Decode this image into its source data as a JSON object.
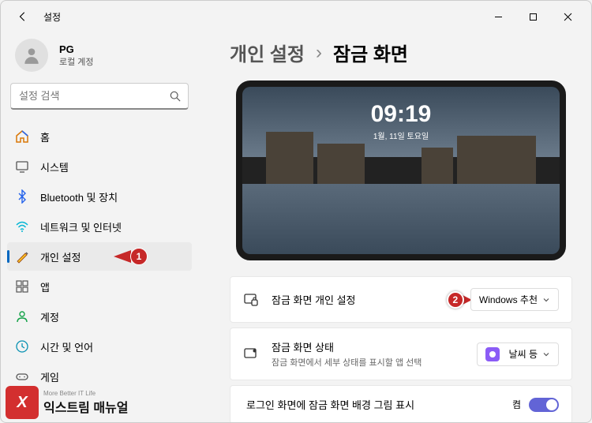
{
  "window": {
    "title": "설정"
  },
  "profile": {
    "name": "PG",
    "sub": "로컬 계정"
  },
  "search": {
    "placeholder": "설정 검색"
  },
  "nav": {
    "home": "홈",
    "system": "시스템",
    "bluetooth": "Bluetooth 및 장치",
    "network": "네트워크 및 인터넷",
    "personalization": "개인 설정",
    "apps": "앱",
    "accounts": "계정",
    "time": "시간 및 언어",
    "gaming": "게임"
  },
  "markers": {
    "one": "1",
    "two": "2"
  },
  "breadcrumb": {
    "prev": "개인 설정",
    "sep": "›",
    "current": "잠금 화면"
  },
  "preview": {
    "time": "09:19",
    "date": "1월, 11일 토요일"
  },
  "cards": {
    "personalize": {
      "title": "잠금 화면 개인 설정",
      "dropdown": "Windows 추천"
    },
    "status": {
      "title": "잠금 화면 상태",
      "sub": "잠금 화면에서 세부 상태를 표시할 앱 선택",
      "dropdown": "날씨 등"
    },
    "bg": {
      "title": "로그인 화면에 잠금 화면 배경 그림 표시",
      "toggle": "켬"
    }
  },
  "watermark": {
    "logo": "X",
    "small": "More Better IT Life",
    "big": "익스트림 매뉴얼"
  }
}
